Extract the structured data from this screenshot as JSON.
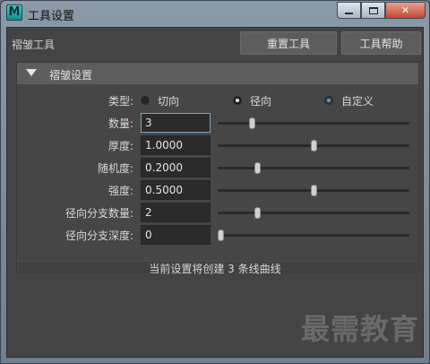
{
  "window": {
    "title": "工具设置",
    "app_icon_letter": "M"
  },
  "header": {
    "tool_name": "褶皱工具",
    "reset_label": "重置工具",
    "help_label": "工具帮助"
  },
  "section": {
    "title": "褶皱设置"
  },
  "type": {
    "label": "类型:",
    "options": [
      {
        "label": "切向",
        "selected": false
      },
      {
        "label": "径向",
        "selected": true
      },
      {
        "label": "自定义",
        "selected": false
      }
    ]
  },
  "params": [
    {
      "label": "数量:",
      "value": "3",
      "slider": 0.17
    },
    {
      "label": "厚度:",
      "value": "1.0000",
      "slider": 0.5
    },
    {
      "label": "随机度:",
      "value": "0.2000",
      "slider": 0.2
    },
    {
      "label": "强度:",
      "value": "0.5000",
      "slider": 0.5
    },
    {
      "label": "径向分支数量:",
      "value": "2",
      "slider": 0.2
    },
    {
      "label": "径向分支深度:",
      "value": "0",
      "slider": 0.0
    }
  ],
  "status_text": "当前设置将创建 3 条线曲线",
  "watermark": "最需教育",
  "colors": {
    "panel": "#444444",
    "field": "#2b2b2b",
    "focus": "#7aa6c8",
    "close": "#c2482f"
  }
}
